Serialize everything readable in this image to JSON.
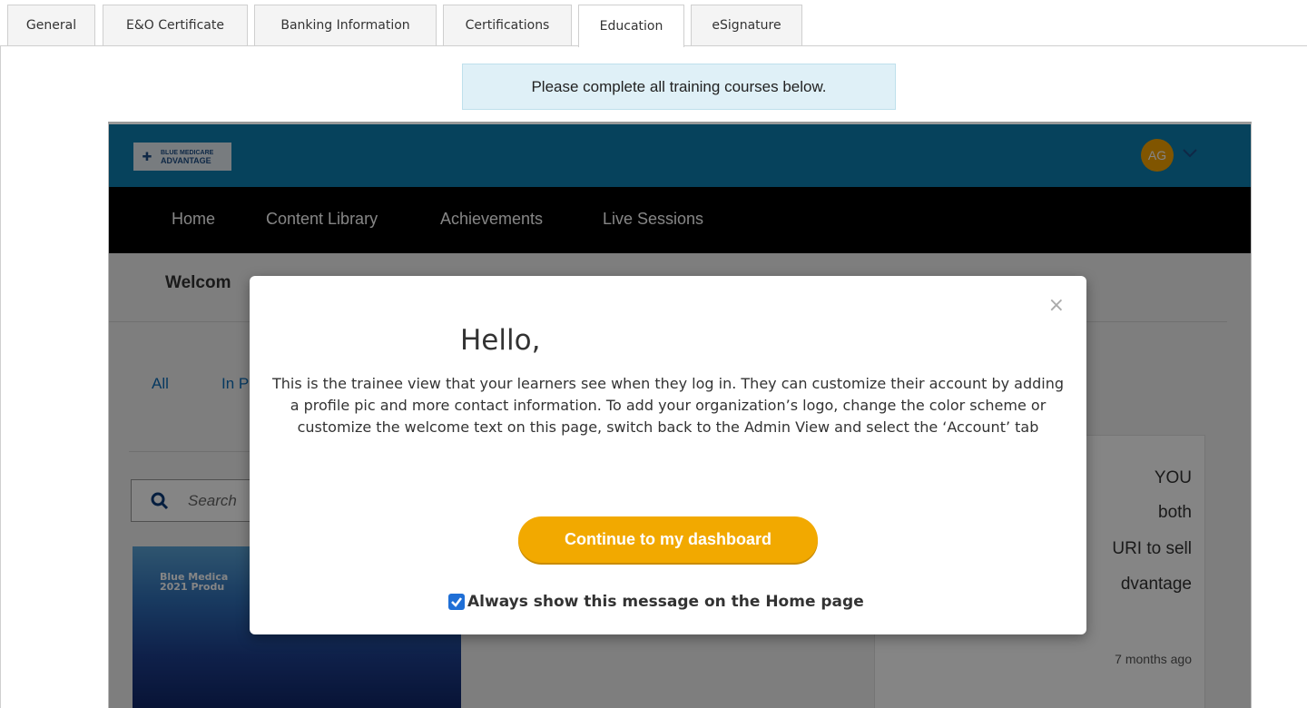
{
  "tabs": [
    {
      "label": "General"
    },
    {
      "label": "E&O Certificate"
    },
    {
      "label": "Banking Information"
    },
    {
      "label": "Certifications"
    },
    {
      "label": "Education"
    },
    {
      "label": "eSignature"
    }
  ],
  "active_tab": "Education",
  "banner_text": "Please complete all training courses below.",
  "portal": {
    "logo_text_line1": "BLUE MEDICARE",
    "logo_text_line2": "ADVANTAGE",
    "avatar_initials": "AG",
    "nav": [
      "Home",
      "Content Library",
      "Achievements",
      "Live Sessions"
    ],
    "welcome_partial": "Welcom",
    "filters": {
      "all": "All",
      "in_progress_partial": "In P"
    },
    "search_placeholder_partial": "Search",
    "course_thumb_line1": "Blue Medica",
    "course_thumb_line2": "2021 Produ",
    "side_card_lines": [
      "YOU",
      "both",
      "URI to sell",
      "dvantage"
    ],
    "side_card_time": "7 months ago"
  },
  "modal": {
    "title": "Hello,",
    "body": "This is the trainee view that your learners see when they log in. They can customize their account by adding a profile pic and more contact information. To add your organization’s logo, change the color scheme or customize the welcome text on this page, switch back to the Admin View and select the ‘Account’ tab",
    "button_label": "Continue to my dashboard",
    "checkbox_label": "Always show this message on the Home page",
    "checkbox_checked": true
  },
  "colors": {
    "portal_header": "#0c7fb0",
    "portal_nav": "#000000",
    "accent_button": "#f2a900",
    "link_blue": "#0b6cb8",
    "banner_bg": "#dff0f7"
  }
}
